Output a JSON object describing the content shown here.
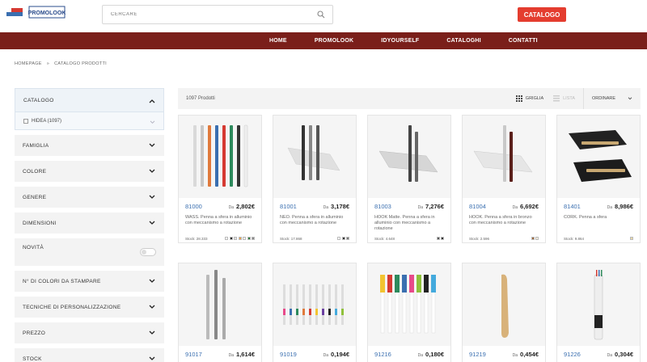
{
  "header": {
    "logo_text": "PROMOLOOK",
    "search_placeholder": "CERCARE",
    "catalogo_button": "CATALOGO"
  },
  "nav": {
    "items": [
      "HOME",
      "PROMOLOOK",
      "IDYOURSELF",
      "CATALOGHI",
      "CONTATTI"
    ]
  },
  "breadcrumb": {
    "items": [
      "HOMEPAGE",
      "CATALOGO PRODOTTI"
    ],
    "separator": "»"
  },
  "sidebar": {
    "catalogo": {
      "label": "CATALOGO",
      "option": "HIDEA (1097)"
    },
    "filters": [
      "FAMIGLIA",
      "COLORE",
      "GENERE",
      "DIMENSIONI"
    ],
    "novita": "NOVITÀ",
    "filters_after": [
      "N° DI COLORI DA STAMPARE",
      "TECNICHE DI PERSONALIZZAZIONE",
      "PREZZO",
      "STOCK"
    ]
  },
  "toolbar": {
    "count": "1097 Prodotti",
    "grid_label": "GRIGLIA",
    "list_label": "LISTA",
    "order_label": "ORDINARE"
  },
  "colors": {
    "nav_bg": "#7a1f1a",
    "accent_red": "#e43d2f",
    "link_blue": "#3a6fb0"
  },
  "products": [
    {
      "code": "81000",
      "price_prefix": "Da",
      "price": "2,802€",
      "desc": "WASS. Penna a sfera in alluminio con meccanismo a rotazione",
      "stock": "Stock: 28.333",
      "swatches": [
        "#ffffff",
        "#222222",
        "#e0e0e0",
        "#e8a14c",
        "#f2f2f2",
        "#2d7a3c",
        "#888888"
      ]
    },
    {
      "code": "81001",
      "price_prefix": "Da",
      "price": "3,178€",
      "desc": "NEO. Penna a sfera in alluminio con meccanismo a rotazione",
      "stock": "Stock: 17.868",
      "swatches": [
        "#ffffff",
        "#333333",
        "#777777"
      ]
    },
    {
      "code": "81003",
      "price_prefix": "Da",
      "price": "7,276€",
      "desc": "HOOK Matte. Penna a sfera in alluminio con meccanismo a rotazione",
      "stock": "Stock: 4.648",
      "swatches": [
        "#555555",
        "#333333"
      ]
    },
    {
      "code": "81004",
      "price_prefix": "Da",
      "price": "6,692€",
      "desc": "HOOK. Penna a sfera in bronzo con meccanismo a rotazione",
      "stock": "Stock: 2.596",
      "swatches": [
        "#a0683a",
        "#f5f0e0"
      ]
    },
    {
      "code": "81401",
      "price_prefix": "Da",
      "price": "8,986€",
      "desc": "CORK. Penna a sfera",
      "stock": "Stock: 9.864",
      "swatches": [
        "#e8d9a8"
      ]
    },
    {
      "code": "91017",
      "price_prefix": "Da",
      "price": "1,614€",
      "desc": "",
      "stock": "",
      "swatches": []
    },
    {
      "code": "91019",
      "price_prefix": "Da",
      "price": "0,194€",
      "desc": "",
      "stock": "",
      "swatches": []
    },
    {
      "code": "91216",
      "price_prefix": "Da",
      "price": "0,180€",
      "desc": "",
      "stock": "",
      "swatches": []
    },
    {
      "code": "91219",
      "price_prefix": "Da",
      "price": "0,454€",
      "desc": "",
      "stock": "",
      "swatches": []
    },
    {
      "code": "91226",
      "price_prefix": "Da",
      "price": "0,304€",
      "desc": "",
      "stock": "",
      "swatches": []
    }
  ]
}
